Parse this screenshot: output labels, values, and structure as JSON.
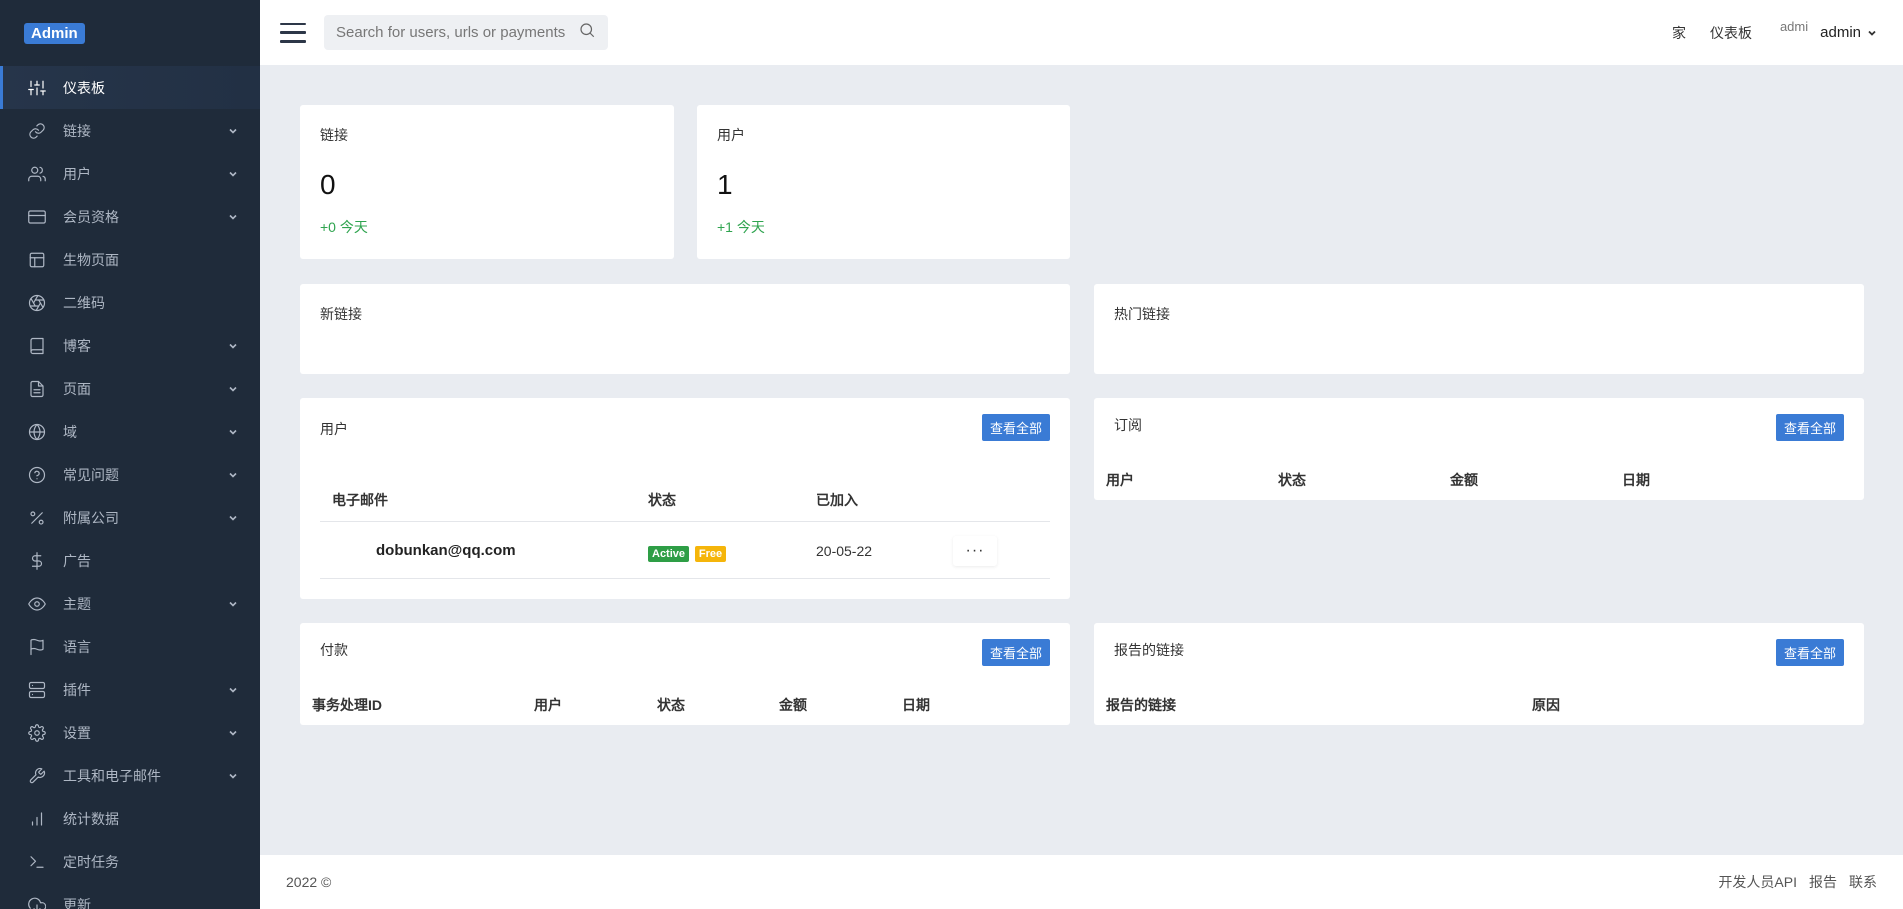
{
  "brand": {
    "label": "Admin",
    "color": "#3a7bd5"
  },
  "sidebar": {
    "items": [
      {
        "label": "仪表板",
        "icon": "sliders-icon",
        "chevron": false,
        "active": true
      },
      {
        "label": "链接",
        "icon": "link-icon",
        "chevron": true
      },
      {
        "label": "用户",
        "icon": "users-icon",
        "chevron": true
      },
      {
        "label": "会员资格",
        "icon": "credit-card-icon",
        "chevron": true
      },
      {
        "label": "生物页面",
        "icon": "layout-icon",
        "chevron": false
      },
      {
        "label": "二维码",
        "icon": "aperture-icon",
        "chevron": false
      },
      {
        "label": "博客",
        "icon": "book-icon",
        "chevron": true
      },
      {
        "label": "页面",
        "icon": "file-icon",
        "chevron": true
      },
      {
        "label": "域",
        "icon": "globe-icon",
        "chevron": true
      },
      {
        "label": "常见问题",
        "icon": "help-circle-icon",
        "chevron": true
      },
      {
        "label": "附属公司",
        "icon": "percent-icon",
        "chevron": true
      },
      {
        "label": "广告",
        "icon": "dollar-icon",
        "chevron": false
      },
      {
        "label": "主题",
        "icon": "eye-icon",
        "chevron": true
      },
      {
        "label": "语言",
        "icon": "flag-icon",
        "chevron": false
      },
      {
        "label": "插件",
        "icon": "server-icon",
        "chevron": true
      },
      {
        "label": "设置",
        "icon": "gear-icon",
        "chevron": true
      },
      {
        "label": "工具和电子邮件",
        "icon": "tool-icon",
        "chevron": true
      },
      {
        "label": "统计数据",
        "icon": "bar-chart-icon",
        "chevron": false
      },
      {
        "label": "定时任务",
        "icon": "terminal-icon",
        "chevron": false
      },
      {
        "label": "更新",
        "icon": "download-cloud-icon",
        "chevron": false
      }
    ]
  },
  "header": {
    "search_placeholder": "Search for users, urls or payments",
    "links": [
      "家",
      "仪表板"
    ],
    "avatar_alt": "admi",
    "user_name": "admin"
  },
  "stats": {
    "links": {
      "title": "链接",
      "value": "0",
      "delta": "+0 今天"
    },
    "users": {
      "title": "用户",
      "value": "1",
      "delta": "+1 今天"
    }
  },
  "new_links": {
    "title": "新链接"
  },
  "popular_links": {
    "title": "热门链接"
  },
  "users_table": {
    "title": "用户",
    "view_all": "查看全部",
    "headers": [
      "电子邮件",
      "状态",
      "已加入"
    ],
    "rows": [
      {
        "email": "dobunkan@qq.com",
        "status": "Active",
        "plan": "Free",
        "joined": "20-05-22",
        "more": "···"
      }
    ]
  },
  "subscriptions": {
    "title": "订阅",
    "view_all": "查看全部",
    "headers": [
      "用户",
      "状态",
      "金额",
      "日期"
    ]
  },
  "payments": {
    "title": "付款",
    "view_all": "查看全部",
    "headers": [
      "事务处理ID",
      "用户",
      "状态",
      "金额",
      "日期"
    ]
  },
  "reported_links": {
    "title": "报告的链接",
    "view_all": "查看全部",
    "headers": [
      "报告的链接",
      "原因"
    ]
  },
  "footer": {
    "copyright": "2022 ©",
    "links": [
      "开发人员API",
      "报告",
      "联系"
    ]
  }
}
